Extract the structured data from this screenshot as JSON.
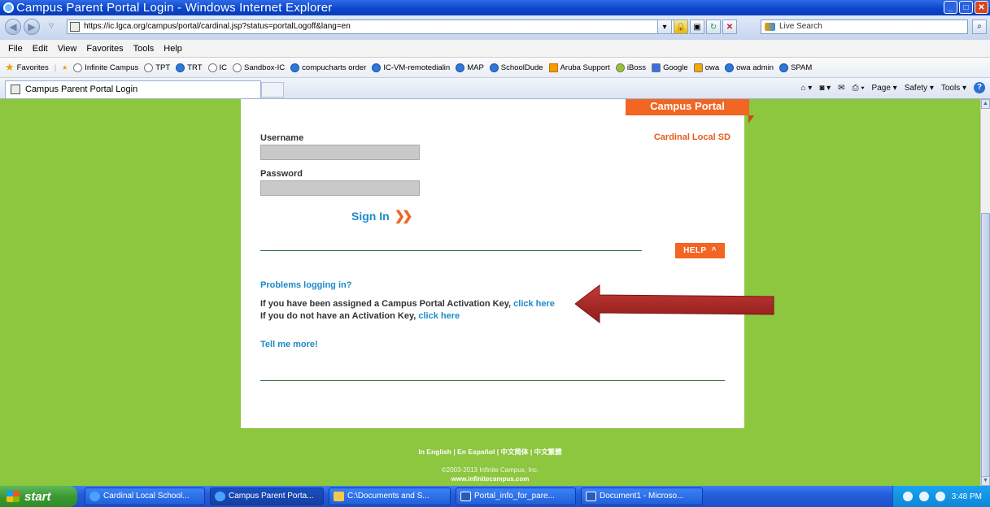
{
  "window": {
    "title": "Campus Parent Portal Login - Windows Internet Explorer"
  },
  "addressbar": {
    "url": "https://ic.lgca.org/campus/portal/cardinal.jsp?status=portalLogoff&lang=en",
    "search_placeholder": "Live Search"
  },
  "menubar": {
    "items": [
      "File",
      "Edit",
      "View",
      "Favorites",
      "Tools",
      "Help"
    ]
  },
  "favorites": {
    "label": "Favorites",
    "items": [
      "Infinite Campus",
      "TPT",
      "TRT",
      "IC",
      "Sandbox-IC",
      "compucharts order",
      "IC-VM-remotedialin",
      "MAP",
      "SchoolDude",
      "Aruba Support",
      "iBoss",
      "Google",
      "owa",
      "owa admin",
      "SPAM"
    ]
  },
  "tab": {
    "title": "Campus Parent Portal Login"
  },
  "commands": {
    "page": "Page ▾",
    "safety": "Safety ▾",
    "tools": "Tools ▾"
  },
  "portal": {
    "tag": "Campus Portal",
    "district": "Cardinal Local SD",
    "username_label": "Username",
    "password_label": "Password",
    "signin": "Sign In",
    "help": "HELP",
    "problems": "Problems logging in?",
    "line1_text": "If you have been assigned a Campus Portal Activation Key, ",
    "line1_link": "click here",
    "line2_text": "If you do not have an Activation Key, ",
    "line2_link": "click here",
    "tellme": "Tell me more!"
  },
  "footer": {
    "langs": "In English | En Español | 中文简体 | 中文繁體",
    "copyright": "©2003-2013 Infinite Campus, Inc.",
    "site": "www.infinitecampus.com"
  },
  "taskbar": {
    "start": "start",
    "tasks": [
      "Cardinal Local School...",
      "Campus Parent Porta...",
      "C:\\Documents and S...",
      "Portal_info_for_pare...",
      "Document1 - Microso..."
    ],
    "clock": "3:48 PM"
  },
  "colors": {
    "page_bg": "#8dc63f",
    "accent": "#f26522",
    "link": "#1b8bc8"
  }
}
